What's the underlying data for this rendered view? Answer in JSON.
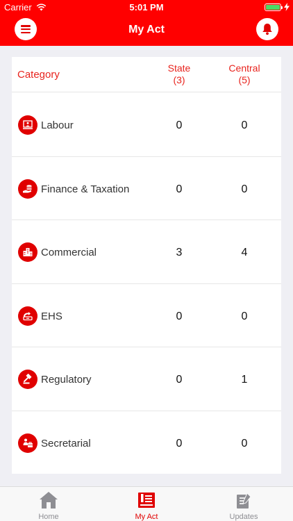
{
  "status_bar": {
    "carrier": "Carrier",
    "time": "5:01 PM",
    "battery_level": 1.0,
    "battery_color": "#4cd964"
  },
  "nav": {
    "title": "My Act",
    "menu_icon": "hamburger-menu-icon",
    "bell_icon": "bell-icon",
    "bar_color": "#ff0000"
  },
  "table": {
    "header": {
      "category": "Category",
      "state_label": "State",
      "state_count": "(3)",
      "central_label": "Central",
      "central_count": "(5)"
    },
    "rows": [
      {
        "icon": "labour-icon",
        "label": "Labour",
        "state": "0",
        "central": "0"
      },
      {
        "icon": "finance-icon",
        "label": "Finance & Taxation",
        "state": "0",
        "central": "0"
      },
      {
        "icon": "commercial-icon",
        "label": "Commercial",
        "state": "3",
        "central": "4"
      },
      {
        "icon": "ehs-icon",
        "label": "EHS",
        "state": "0",
        "central": "0"
      },
      {
        "icon": "gavel-icon",
        "label": "Regulatory",
        "state": "0",
        "central": "1"
      },
      {
        "icon": "secretarial-icon",
        "label": "Secretarial",
        "state": "0",
        "central": "0"
      }
    ]
  },
  "tab_bar": {
    "tabs": [
      {
        "label": "Home",
        "icon": "home-icon",
        "active": false
      },
      {
        "label": "My Act",
        "icon": "my-act-icon",
        "active": true
      },
      {
        "label": "Updates",
        "icon": "updates-icon",
        "active": false
      }
    ],
    "active_color": "#e00000",
    "inactive_color": "#8e8e93"
  }
}
